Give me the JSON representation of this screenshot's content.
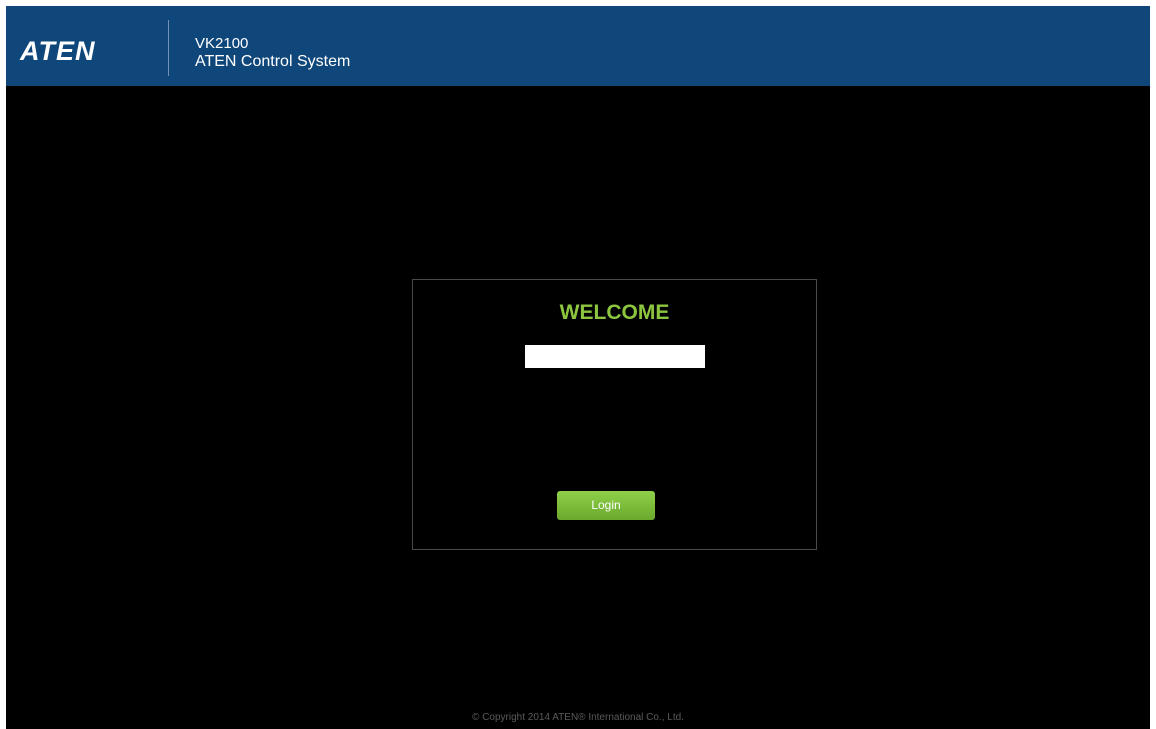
{
  "header": {
    "logo_text": "ATEN",
    "model": "VK2100",
    "product_name": "ATEN Control System"
  },
  "login": {
    "welcome": "WELCOME",
    "username_value": "",
    "button_label": "Login"
  },
  "footer": {
    "copyright": "© Copyright 2014 ATEN® International Co., Ltd."
  },
  "colors": {
    "header_bg": "#10477a",
    "page_bg": "#000000",
    "accent_green": "#8cc63f"
  }
}
